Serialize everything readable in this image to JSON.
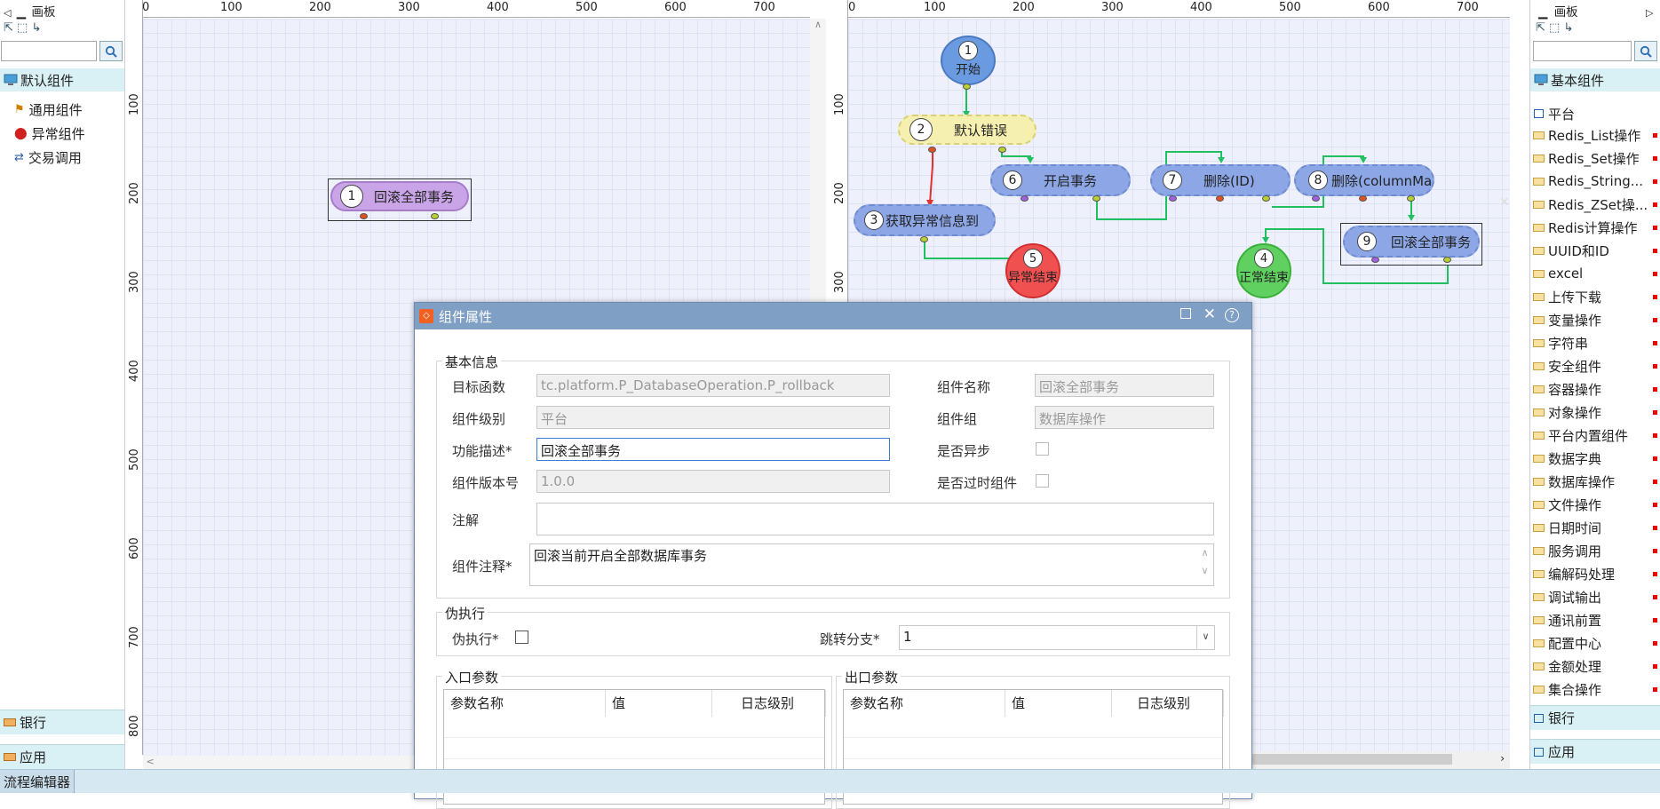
{
  "left_panel": {
    "title": "画板",
    "tree": [
      {
        "label": "默认组件",
        "icon": "monitor-icon"
      },
      {
        "label": "通用组件",
        "icon": "component-icon"
      },
      {
        "label": "异常组件",
        "icon": "error-icon"
      },
      {
        "label": "交易调用",
        "icon": "exchange-icon"
      }
    ],
    "sections": [
      "银行",
      "应用"
    ]
  },
  "right_panel": {
    "title": "画板",
    "sections_top": [
      "基本组件",
      "平台"
    ],
    "items": [
      "Redis_List操作",
      "Redis_Set操作",
      "Redis_String...",
      "Redis_ZSet操...",
      "Redis计算操作",
      "UUID和ID",
      "excel",
      "上传下载",
      "变量操作",
      "字符串",
      "安全组件",
      "容器操作",
      "对象操作",
      "平台内置组件",
      "数据字典",
      "数据库操作",
      "文件操作",
      "日期时间",
      "服务调用",
      "编解码处理",
      "调试输出",
      "通讯前置",
      "配置中心",
      "金额处理",
      "集合操作"
    ],
    "sections_bottom": [
      "银行",
      "应用"
    ]
  },
  "canvas_left": {
    "ruler_h": [
      "0",
      "100",
      "200",
      "300",
      "400",
      "500",
      "600",
      "700"
    ],
    "ruler_v": [
      "100",
      "200",
      "300",
      "400",
      "500",
      "600",
      "700",
      "800"
    ],
    "nodes": [
      {
        "num": "1",
        "label": "回滚全部事务"
      }
    ]
  },
  "canvas_right": {
    "ruler_h": [
      "0",
      "100",
      "200",
      "300",
      "400",
      "500",
      "600",
      "700"
    ],
    "ruler_v": [
      "100",
      "200",
      "300"
    ],
    "nodes": [
      {
        "num": "1",
        "label": "开始"
      },
      {
        "num": "2",
        "label": "默认错误"
      },
      {
        "num": "3",
        "label": "获取异常信息到"
      },
      {
        "num": "4",
        "label": "正常结束"
      },
      {
        "num": "5",
        "label": "异常结束"
      },
      {
        "num": "6",
        "label": "开启事务"
      },
      {
        "num": "7",
        "label": "删除(ID)"
      },
      {
        "num": "8",
        "label": "删除(columnMap)"
      },
      {
        "num": "9",
        "label": "回滚全部事务"
      }
    ]
  },
  "dialog": {
    "title": "组件属性",
    "basic_legend": "基本信息",
    "target_func_label": "目标函数",
    "target_func_value": "tc.platform.P_DatabaseOperation.P_rollback",
    "comp_name_label": "组件名称",
    "comp_name_value": "回滚全部事务",
    "comp_level_label": "组件级别",
    "comp_level_value": "平台",
    "comp_group_label": "组件组",
    "comp_group_value": "数据库操作",
    "func_desc_label": "功能描述*",
    "func_desc_value": "回滚全部事务",
    "async_label": "是否异步",
    "version_label": "组件版本号",
    "version_value": "1.0.0",
    "deprecated_label": "是否过时组件",
    "note_label": "注解",
    "note_value": "",
    "comment_label": "组件注释*",
    "comment_value": "回滚当前开启全部数据库事务",
    "fake_legend": "伪执行",
    "fake_label": "伪执行*",
    "branch_label": "跳转分支*",
    "branch_value": "1",
    "in_legend": "入口参数",
    "out_legend": "出口参数",
    "cols": [
      "参数名称",
      "值",
      "日志级别"
    ]
  },
  "status": {
    "tab": "流程编辑器"
  }
}
